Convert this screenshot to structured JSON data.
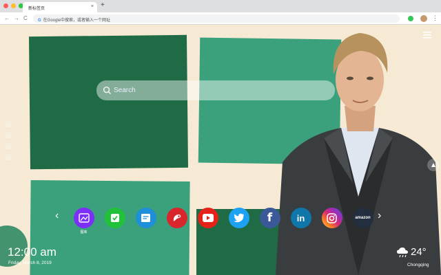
{
  "browser": {
    "tab_title": "新标签页",
    "tab_close": "×",
    "new_tab": "+",
    "back": "←",
    "forward": "→",
    "reload": "C",
    "omnibox_engine": "G",
    "omnibox_text": "在Google中搜索，或者输入一个网址",
    "menu": "⋮",
    "traffic_lights": [
      "#ff5f57",
      "#febc2e",
      "#28c840"
    ]
  },
  "search": {
    "placeholder": "Search"
  },
  "apps": [
    {
      "name": "gallery",
      "icon": "image-icon",
      "label": "图库",
      "color": "#7b2ff7"
    },
    {
      "name": "tasks",
      "icon": "check-icon",
      "label": "",
      "color": "#21c23a"
    },
    {
      "name": "notes",
      "icon": "note-icon",
      "label": "",
      "color": "#1e8fd8"
    },
    {
      "name": "game",
      "icon": "game-icon",
      "label": "",
      "color": "#d8262c"
    },
    {
      "name": "youtube",
      "icon": "youtube-icon",
      "label": "",
      "color": "#e62117"
    },
    {
      "name": "twitter",
      "icon": "twitter-icon",
      "label": "",
      "color": "#1da1f2"
    },
    {
      "name": "facebook",
      "icon": "facebook-icon",
      "label": "f",
      "color": "#3b5998"
    },
    {
      "name": "linkedin",
      "icon": "linkedin-icon",
      "label": "in",
      "color": "#0e76a8"
    },
    {
      "name": "instagram",
      "icon": "instagram-icon",
      "label": "",
      "color": "#d62976"
    },
    {
      "name": "amazon",
      "icon": "amazon-icon",
      "label": "amazon",
      "color": "#232f3e"
    }
  ],
  "carousel": {
    "prev": "‹",
    "next": "›"
  },
  "clock": {
    "time": "12:00 am",
    "date": "Friday, March 8, 2019"
  },
  "weather": {
    "icon": "cloud-rain-icon",
    "temperature": "24°",
    "city": "Chongqing"
  }
}
